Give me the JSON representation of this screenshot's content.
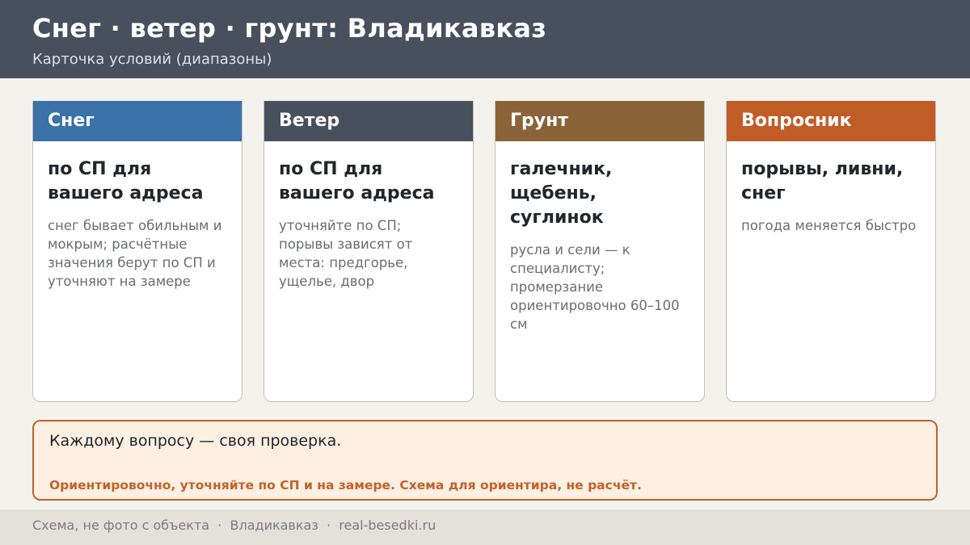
{
  "header": {
    "title": "Снег · ветер · грунт: Владикавказ",
    "subtitle": "Карточка условий (диапазоны)"
  },
  "cards": [
    {
      "title": "Снег",
      "color": "#3b72a8",
      "main": "по СП для вашего адреса",
      "sub": "снег бывает обильным и мокрым; расчётные значения берут по СП и уточняют на замере"
    },
    {
      "title": "Ветер",
      "color": "#47505c",
      "main": "по СП для вашего адреса",
      "sub": "уточняйте по СП; порывы зависят от места: предгорье, ущелье, двор"
    },
    {
      "title": "Грунт",
      "color": "#8a6339",
      "main": "галечник, щебень, суглинок",
      "sub": "русла и сели — к специалисту; промерзание ориентировочно 60–100 см"
    },
    {
      "title": "Вопросник",
      "color": "#c25c27",
      "main": "порывы, ливни, снег",
      "sub": "погода меняется быстро"
    }
  ],
  "note": {
    "main": "Каждому вопросу — своя проверка.",
    "warning": "Ориентировочно, уточняйте по СП и на замере. Схема для ориентира, не расчёт."
  },
  "footer": {
    "text": "Схема, не фото с объекта  ·  Владикавказ  ·  real-besedki.ru"
  }
}
